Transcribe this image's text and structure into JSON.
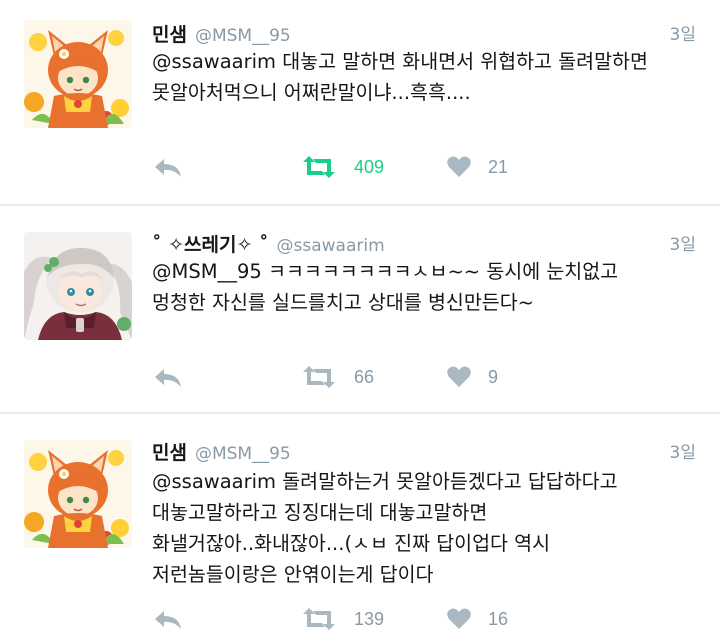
{
  "colors": {
    "retweet_active": "#19cf86",
    "icon_muted": "#aab8c2",
    "text_muted": "#8899a6",
    "divider": "#e6ecf0"
  },
  "tweets": [
    {
      "name": "민샘",
      "handle": "@MSM__95",
      "time": "3일",
      "lines": [
        "@ssawaarim 대놓고 말하면 화내면서 위협하고 돌려말하면",
        "못알아처먹으니 어쩌란말이냐...흑흑...."
      ],
      "retweets": "409",
      "retweeted": true,
      "likes": "21",
      "avatar_icon": "fox-girl-avatar"
    },
    {
      "name": "˚ ✧쓰레기✧ ˚",
      "handle": "@ssawaarim",
      "time": "3일",
      "lines": [
        "@MSM__95 ㅋㅋㅋㅋㅋㅋㅋㅋㅅㅂ~~ 동시에 눈치없고",
        "멍청한 자신를 실드를치고 상대를 병신만든다~"
      ],
      "retweets": "66",
      "retweeted": false,
      "likes": "9",
      "avatar_icon": "white-haired-girl-avatar"
    },
    {
      "name": "민샘",
      "handle": "@MSM__95",
      "time": "3일",
      "lines": [
        "@ssawaarim 돌려말하는거 못알아듣겠다고 답답하다고",
        "대놓고말하라고 징징대는데 대놓고말하면",
        "화낼거잖아..화내잖아...(ㅅㅂ 진짜 답이업다 역시",
        "저런놈들이랑은 안엮이는게 답이다"
      ],
      "retweets": "139",
      "retweeted": false,
      "likes": "16",
      "avatar_icon": "fox-girl-avatar"
    }
  ]
}
